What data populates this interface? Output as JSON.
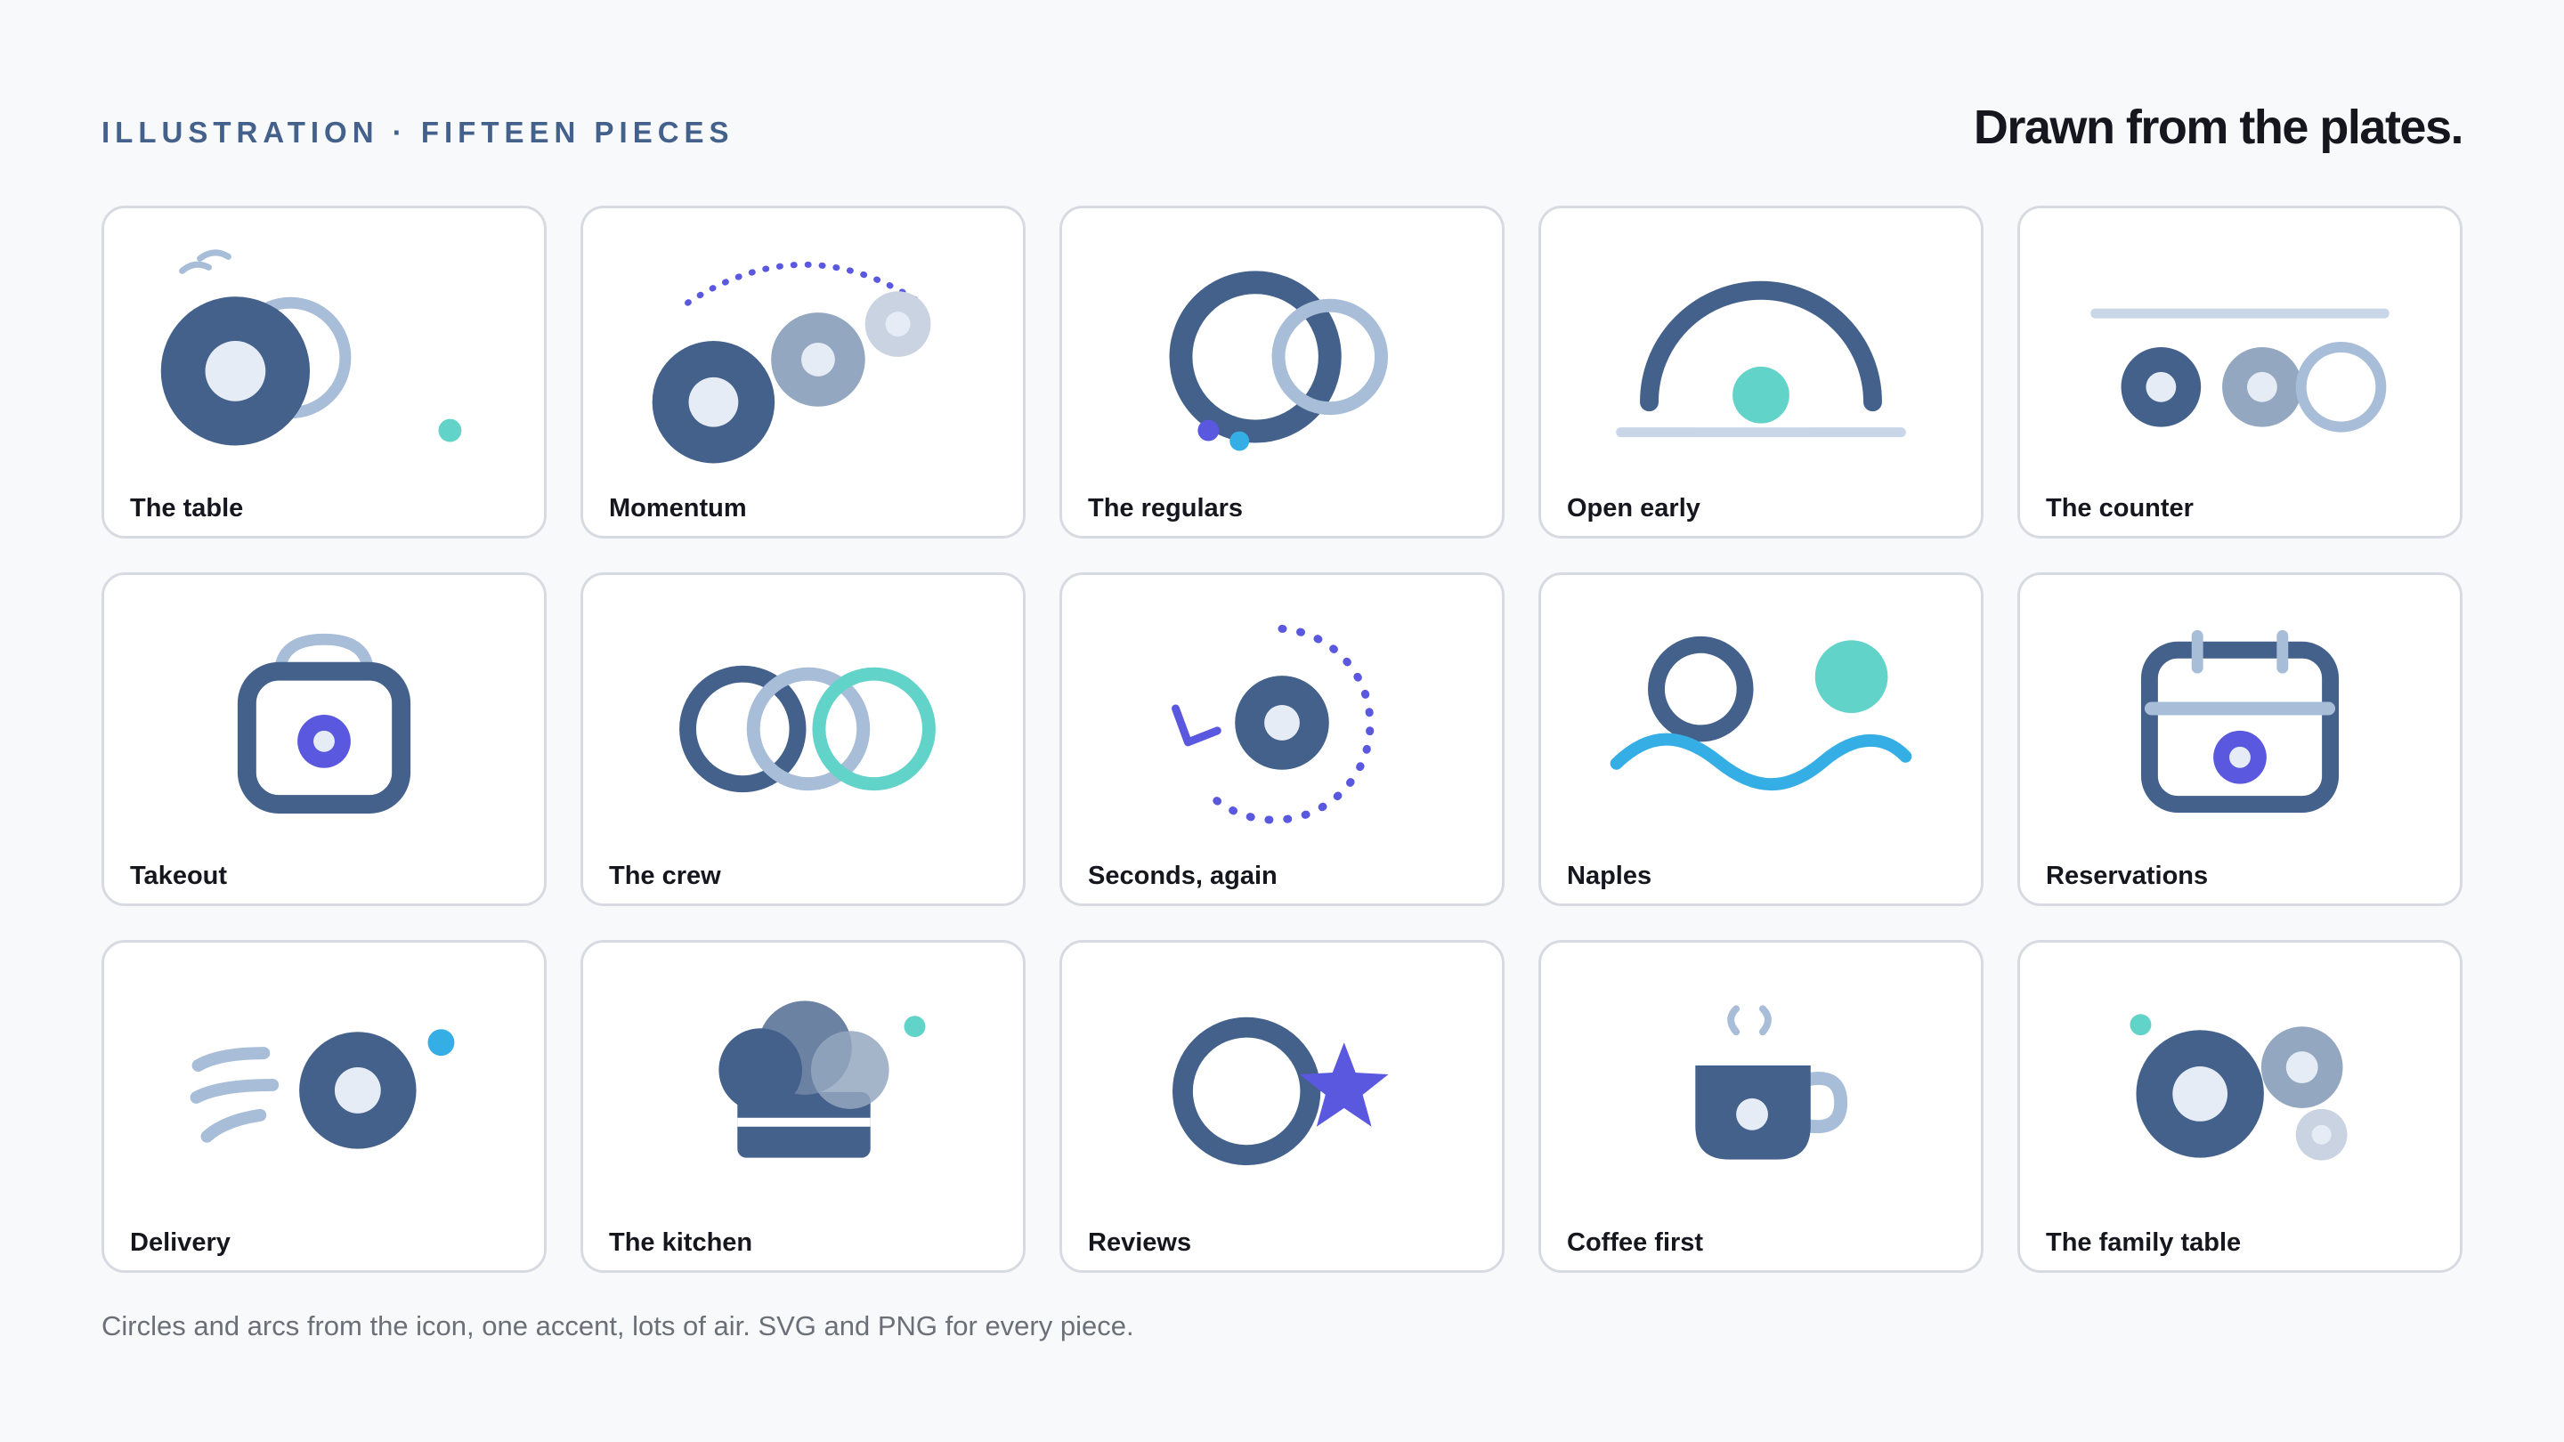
{
  "header": {
    "eyebrow": "ILLUSTRATION · FIFTEEN PIECES",
    "headline": "Drawn from the plates."
  },
  "colors": {
    "navy": "#43618b",
    "navy_light": "#a8bdd8",
    "gray_blue": "#94a7c0",
    "teal": "#62d3c9",
    "indigo": "#5b58e0",
    "sky": "#35aee6",
    "plate_center": "#e6ecf5"
  },
  "cards": [
    {
      "label": "The table",
      "icon": "table-plates-icon"
    },
    {
      "label": "Momentum",
      "icon": "momentum-icon"
    },
    {
      "label": "The regulars",
      "icon": "regulars-icon"
    },
    {
      "label": "Open early",
      "icon": "sunrise-icon"
    },
    {
      "label": "The counter",
      "icon": "counter-icon"
    },
    {
      "label": "Takeout",
      "icon": "takeout-bag-icon"
    },
    {
      "label": "The crew",
      "icon": "crew-rings-icon"
    },
    {
      "label": "Seconds, again",
      "icon": "seconds-cycle-icon"
    },
    {
      "label": "Naples",
      "icon": "naples-waves-icon"
    },
    {
      "label": "Reservations",
      "icon": "calendar-icon"
    },
    {
      "label": "Delivery",
      "icon": "delivery-speed-icon"
    },
    {
      "label": "The kitchen",
      "icon": "chef-hat-icon"
    },
    {
      "label": "Reviews",
      "icon": "review-star-icon"
    },
    {
      "label": "Coffee first",
      "icon": "coffee-cup-icon"
    },
    {
      "label": "The family table",
      "icon": "family-plates-icon"
    }
  ],
  "footer": {
    "caption": "Circles and arcs from the icon, one accent, lots of air. SVG and PNG for every piece."
  }
}
